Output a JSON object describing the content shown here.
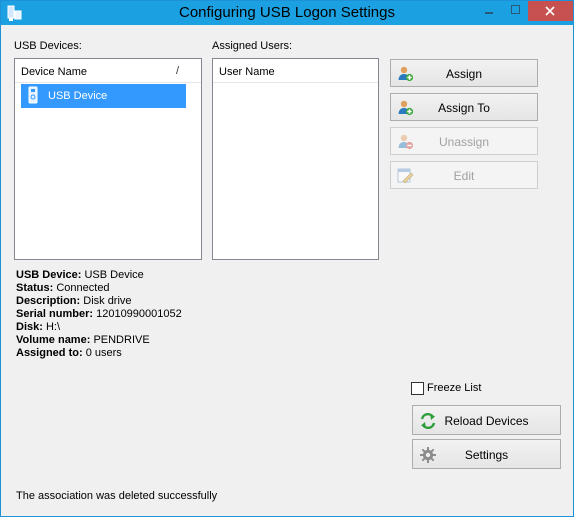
{
  "window": {
    "title": "Configuring USB Logon Settings",
    "titlebar_color": "#1ba1e2",
    "close_color": "#c75050"
  },
  "usb_devices": {
    "label": "USB Devices:",
    "column_header": "Device Name",
    "column_sep": "/",
    "items": [
      {
        "label": "USB Device",
        "selected": true,
        "icon": "usb-drive-icon"
      }
    ]
  },
  "assigned_users": {
    "label": "Assigned Users:",
    "column_header": "User Name",
    "items": []
  },
  "actions": {
    "assign": {
      "label": "Assign",
      "icon": "user-add-icon",
      "enabled": true
    },
    "assign_to": {
      "label": "Assign To",
      "icon": "user-add-icon",
      "enabled": true
    },
    "unassign": {
      "label": "Unassign",
      "icon": "user-remove-icon",
      "enabled": false
    },
    "edit": {
      "label": "Edit",
      "icon": "edit-icon",
      "enabled": false
    }
  },
  "details": {
    "usb_device_key": "USB Device:",
    "usb_device_val": "USB Device",
    "status_key": "Status:",
    "status_val": "Connected",
    "description_key": "Description:",
    "description_val": "Disk drive",
    "serial_key": "Serial number:",
    "serial_val": "12010990001052",
    "disk_key": "Disk:",
    "disk_val": "H:\\",
    "volume_key": "Volume name:",
    "volume_val": "PENDRIVE",
    "assigned_key": "Assigned to:",
    "assigned_val": "0 users"
  },
  "freeze_list": {
    "label": "Freeze List",
    "checked": false
  },
  "reload": {
    "label": "Reload Devices",
    "icon": "refresh-icon"
  },
  "settings": {
    "label": "Settings",
    "icon": "gear-icon"
  },
  "status_message": "The association was deleted successfully"
}
